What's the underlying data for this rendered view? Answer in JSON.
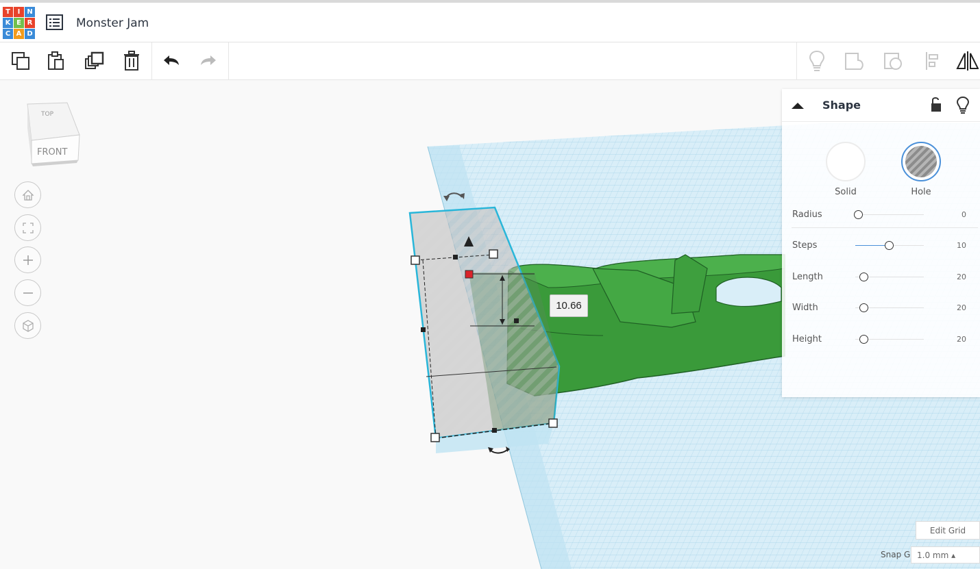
{
  "app": {
    "logo_letters": [
      "T",
      "I",
      "N",
      "K",
      "E",
      "R",
      "C",
      "A",
      "D"
    ],
    "logo_colors": [
      "#e8432b",
      "#e8432b",
      "#3a8bd8",
      "#3a8bd8",
      "#72c04c",
      "#e8432b",
      "#3a8bd8",
      "#f29b1b",
      "#3a8bd8"
    ],
    "design_name": "Monster Jam"
  },
  "toolbar": {
    "left_tools": [
      "copy-icon",
      "paste-icon",
      "duplicate-icon",
      "delete-icon",
      "undo-icon",
      "redo-icon"
    ],
    "right_tools": [
      "show-hints-icon",
      "group-icon",
      "ungroup-icon",
      "align-icon",
      "mirror-icon"
    ]
  },
  "view": {
    "cube_top": "TOP",
    "cube_front": "FRONT",
    "nav_buttons": [
      "home-view-icon",
      "fit-view-icon",
      "zoom-in-icon",
      "zoom-out-icon",
      "perspective-icon"
    ]
  },
  "measurement": {
    "value": "10.66"
  },
  "shape_panel": {
    "title": "Shape",
    "solid_label": "Solid",
    "hole_label": "Hole",
    "selected_type": "Hole",
    "params": [
      {
        "label": "Radius",
        "value": "0",
        "fraction": 0.0
      },
      {
        "label": "Steps",
        "value": "10",
        "fraction": 0.45
      },
      {
        "label": "Length",
        "value": "20",
        "fraction": 0.08
      },
      {
        "label": "Width",
        "value": "20",
        "fraction": 0.08
      },
      {
        "label": "Height",
        "value": "20",
        "fraction": 0.08
      }
    ]
  },
  "grid": {
    "edit_grid_label": "Edit Grid",
    "snap_label": "Snap Grid",
    "snap_value": "1.0 mm ▴"
  },
  "colors": {
    "accent": "#4a90d9",
    "model_green": "#3a9a3a",
    "workplane_blue": "#bfe3f2"
  }
}
